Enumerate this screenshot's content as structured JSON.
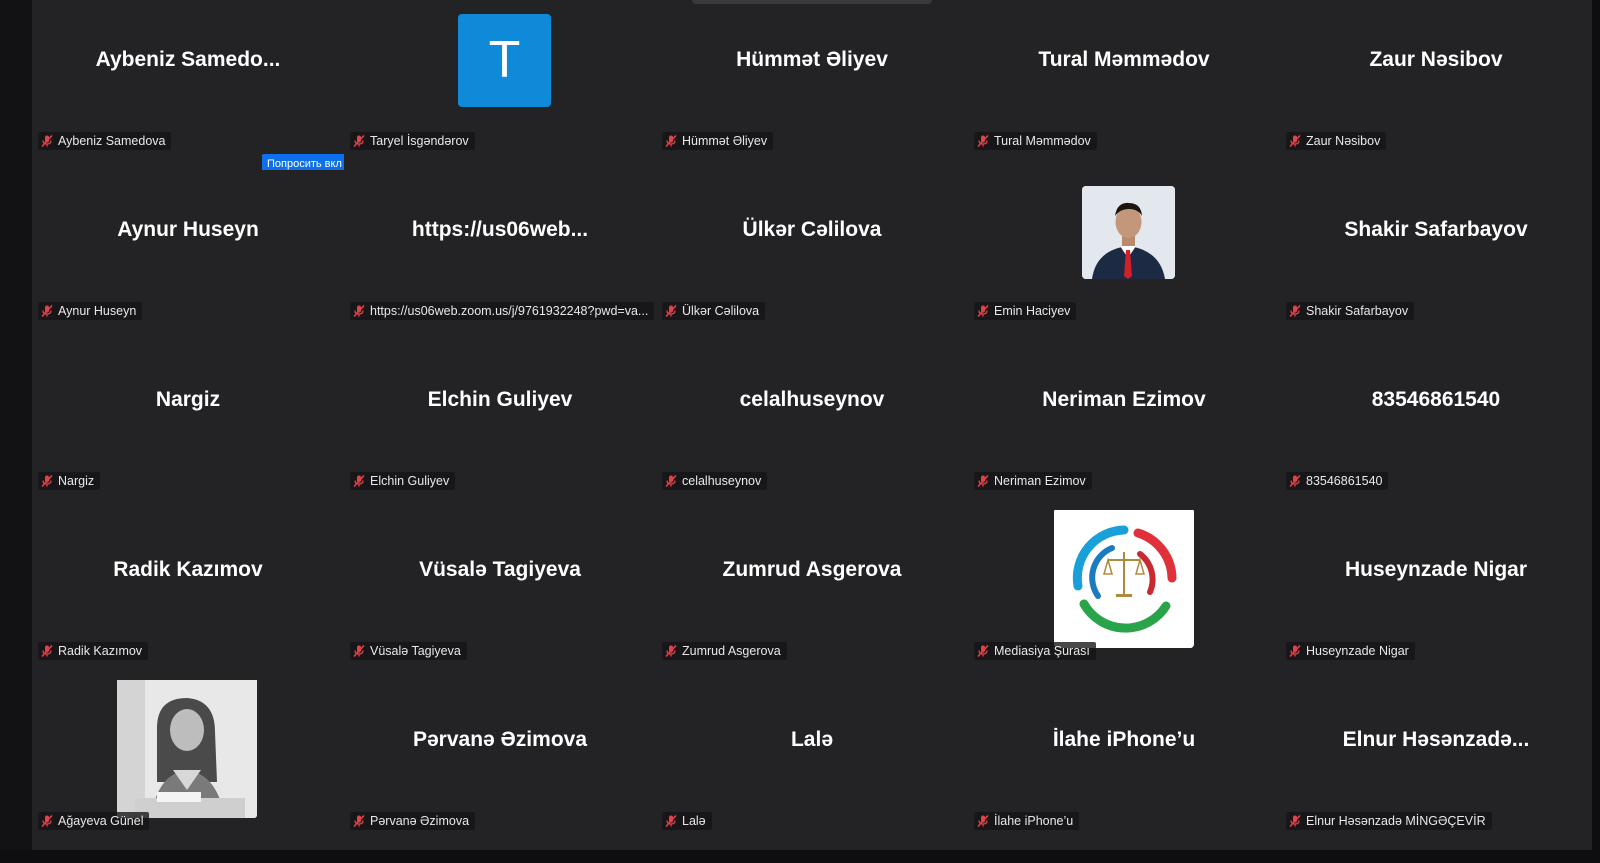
{
  "colors": {
    "tile_bg": "#232325",
    "mute_icon": "#e0424b",
    "accent": "#0e71eb",
    "avatar_t_bg": "#0e8ad8"
  },
  "ask_unmute": {
    "label": "Попросить вкл",
    "more_label": "···"
  },
  "participants": [
    {
      "display": "Aybeniz  Samedo...",
      "label": "Aybeniz Samedova",
      "muted": true
    },
    {
      "display": "T",
      "label": "Taryel İsgəndərov",
      "muted": true,
      "avatar": "letter"
    },
    {
      "display": "Hümmət Əliyev",
      "label": "Hümmət Əliyev",
      "muted": true
    },
    {
      "display": "Tural Məmmədov",
      "label": "Tural Məmmədov",
      "muted": true
    },
    {
      "display": "Zaur Nəsibov",
      "label": "Zaur Nəsibov",
      "muted": true
    },
    {
      "display": "Aynur Huseyn",
      "label": "Aynur Huseyn",
      "muted": true
    },
    {
      "display": "https://us06web...",
      "label": "https://us06web.zoom.us/j/9761932248?pwd=va...",
      "muted": true
    },
    {
      "display": "Ülkər Cəlilova",
      "label": "Ülkər Cəlilova",
      "muted": true
    },
    {
      "display": "",
      "label": "Emin Haciyev",
      "muted": true,
      "avatar": "photo-man"
    },
    {
      "display": "Shakir Safarbayov",
      "label": "Shakir Safarbayov",
      "muted": true
    },
    {
      "display": "Nargiz",
      "label": "Nargiz",
      "muted": true
    },
    {
      "display": "Elchin Guliyev",
      "label": "Elchin Guliyev",
      "muted": true
    },
    {
      "display": "celalhuseynov",
      "label": "celalhuseynov",
      "muted": true
    },
    {
      "display": "Neriman Ezimov",
      "label": "Neriman Ezimov",
      "muted": true
    },
    {
      "display": "83546861540",
      "label": "83546861540",
      "muted": true
    },
    {
      "display": "Radik Kazımov",
      "label": "Radik Kazımov",
      "muted": true
    },
    {
      "display": "Vüsalə Tagiyeva",
      "label": "Vüsalə Tagiyeva",
      "muted": true
    },
    {
      "display": "Zumrud Asgerova",
      "label": "Zumrud Asgerova",
      "muted": true
    },
    {
      "display": "",
      "label": "Mediasiya Şurası",
      "muted": true,
      "avatar": "logo"
    },
    {
      "display": "Huseynzade Nigar",
      "label": "Huseynzade Nigar",
      "muted": true
    },
    {
      "display": "",
      "label": "Ağayeva Günel",
      "muted": true,
      "avatar": "photo-woman"
    },
    {
      "display": "Pərvanə Əzimova",
      "label": "Pərvanə Əzimova",
      "muted": true
    },
    {
      "display": "Lalə",
      "label": "Lalə",
      "muted": true
    },
    {
      "display": "İlahe iPhone’u",
      "label": "İlahe iPhone’u",
      "muted": true
    },
    {
      "display": "Elnur  Həsənzadə...",
      "label": "Elnur Həsənzadə MİNGƏÇEVİR",
      "muted": true
    }
  ]
}
